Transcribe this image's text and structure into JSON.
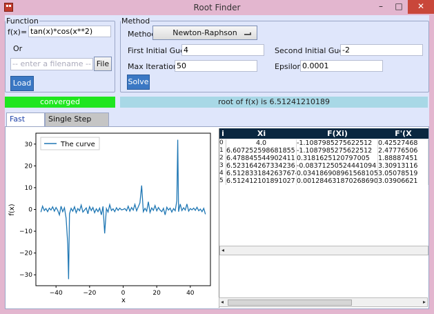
{
  "window": {
    "title": "Root Finder",
    "app_icon": "app-icon"
  },
  "function_group": {
    "legend": "Function",
    "fx_label": "f(x)=",
    "fx_value": "tan(x)*cos(x**2)",
    "or_label": "Or",
    "filename_placeholder": "-- enter a filename --",
    "file_button": "File",
    "load_button": "Load"
  },
  "method_group": {
    "legend": "Method",
    "method_label": "Method",
    "method_value": "Newton-Raphson",
    "first_guess_label": "First Initial Guess",
    "first_guess_value": "4",
    "second_guess_label": "Second Initial Guess",
    "second_guess_value": "-2",
    "max_iter_label": "Max Iterations",
    "max_iter_value": "50",
    "epsilon_label": "Epsilon",
    "epsilon_value": "0.0001",
    "solve_button": "Solve"
  },
  "status": {
    "state": "converged",
    "result": "root of f(x) is 6.51241210189"
  },
  "tabs": [
    "Fast Mode",
    "Single Step Mode"
  ],
  "table": {
    "headers": [
      "i",
      "Xi",
      "F(Xi)",
      "F'(X"
    ],
    "rows": [
      [
        "0",
        "4.0",
        "-1.1087985275622512",
        "0.42527468"
      ],
      [
        "1",
        "6.607252598681855",
        "-1.1087985275622512",
        "2.47776506"
      ],
      [
        "2",
        "6.478845544902411",
        "0.3181625120797005",
        "1.88887451"
      ],
      [
        "3",
        "6.523164267334236",
        "-0.08371250524441094",
        "3.30913116"
      ],
      [
        "4",
        "6.5128331842637674",
        "0.034186908961568105",
        "3.05078519"
      ],
      [
        "5",
        "6.512412101891027",
        "0.0012846318702686903",
        "3.03906621"
      ]
    ]
  },
  "chart_data": {
    "type": "line",
    "series": [
      {
        "name": "The curve",
        "color": "#1f77b4",
        "x": [
          -49,
          -48,
          -47,
          -46,
          -45,
          -44,
          -43,
          -42,
          -41,
          -40,
          -39,
          -38,
          -37,
          -36,
          -35,
          -34,
          -33,
          -32.5,
          -32,
          -31,
          -30,
          -29,
          -28,
          -27,
          -26,
          -25,
          -24,
          -23,
          -22,
          -21,
          -20,
          -19,
          -18,
          -17,
          -16,
          -15,
          -14,
          -13,
          -12,
          -11,
          -10,
          -9,
          -8,
          -7,
          -6,
          -5,
          -4,
          -3,
          -2,
          -1,
          0,
          1,
          2,
          3,
          4,
          5,
          6,
          7,
          8,
          9,
          10,
          11,
          12,
          13,
          14,
          15,
          16,
          17,
          18,
          19,
          20,
          21,
          22,
          23,
          24,
          25,
          26,
          27,
          28,
          29,
          30,
          31,
          32,
          32.5,
          33,
          34,
          35,
          36,
          37,
          38,
          39,
          40,
          41,
          42,
          43,
          44,
          45,
          46,
          47,
          48,
          49
        ],
        "y": [
          -1.2,
          1.5,
          -0.5,
          0.4,
          -1.0,
          0.6,
          -0.3,
          1.2,
          -0.8,
          0.9,
          -0.4,
          -2.5,
          1.5,
          -1.0,
          0.8,
          -4.0,
          -16.0,
          -32.0,
          -2.0,
          0.5,
          -0.8,
          1.2,
          -1.5,
          0.4,
          -0.6,
          2.0,
          -1.2,
          -0.3,
          0.7,
          -2.0,
          1.3,
          -0.5,
          0.9,
          -1.5,
          0.3,
          -1.0,
          0.6,
          -2.5,
          1.4,
          -11.0,
          0.4,
          -1.2,
          2.2,
          -0.5,
          0.3,
          -1.0,
          0.8,
          -0.4,
          0.6,
          -0.2,
          0.0,
          0.4,
          -0.6,
          1.5,
          -0.8,
          0.9,
          -0.3,
          2.3,
          -0.6,
          1.2,
          3.0,
          11.0,
          -1.0,
          0.5,
          -0.8,
          3.5,
          -1.4,
          0.7,
          -0.4,
          1.8,
          -0.6,
          0.9,
          -0.3,
          -1.0,
          0.5,
          -2.5,
          1.0,
          -0.3,
          0.6,
          -1.2,
          0.4,
          -0.6,
          4.0,
          32.0,
          -1.0,
          2.5,
          -0.5,
          0.8,
          -0.3,
          2.5,
          -0.8,
          0.4,
          -0.2,
          0.6,
          -0.4,
          1.0,
          -0.6,
          0.2,
          -1.0,
          0.5,
          -2.2
        ]
      }
    ],
    "xlabel": "x",
    "ylabel": "f(x)",
    "xlim": [
      -52,
      52
    ],
    "ylim": [
      -35,
      35
    ],
    "xticks": [
      "−40",
      "−20",
      "0",
      "20",
      "40"
    ],
    "yticks": [
      "30",
      "20",
      "10",
      "0",
      "−10",
      "−20",
      "−30"
    ],
    "legend_position": "top-left"
  }
}
